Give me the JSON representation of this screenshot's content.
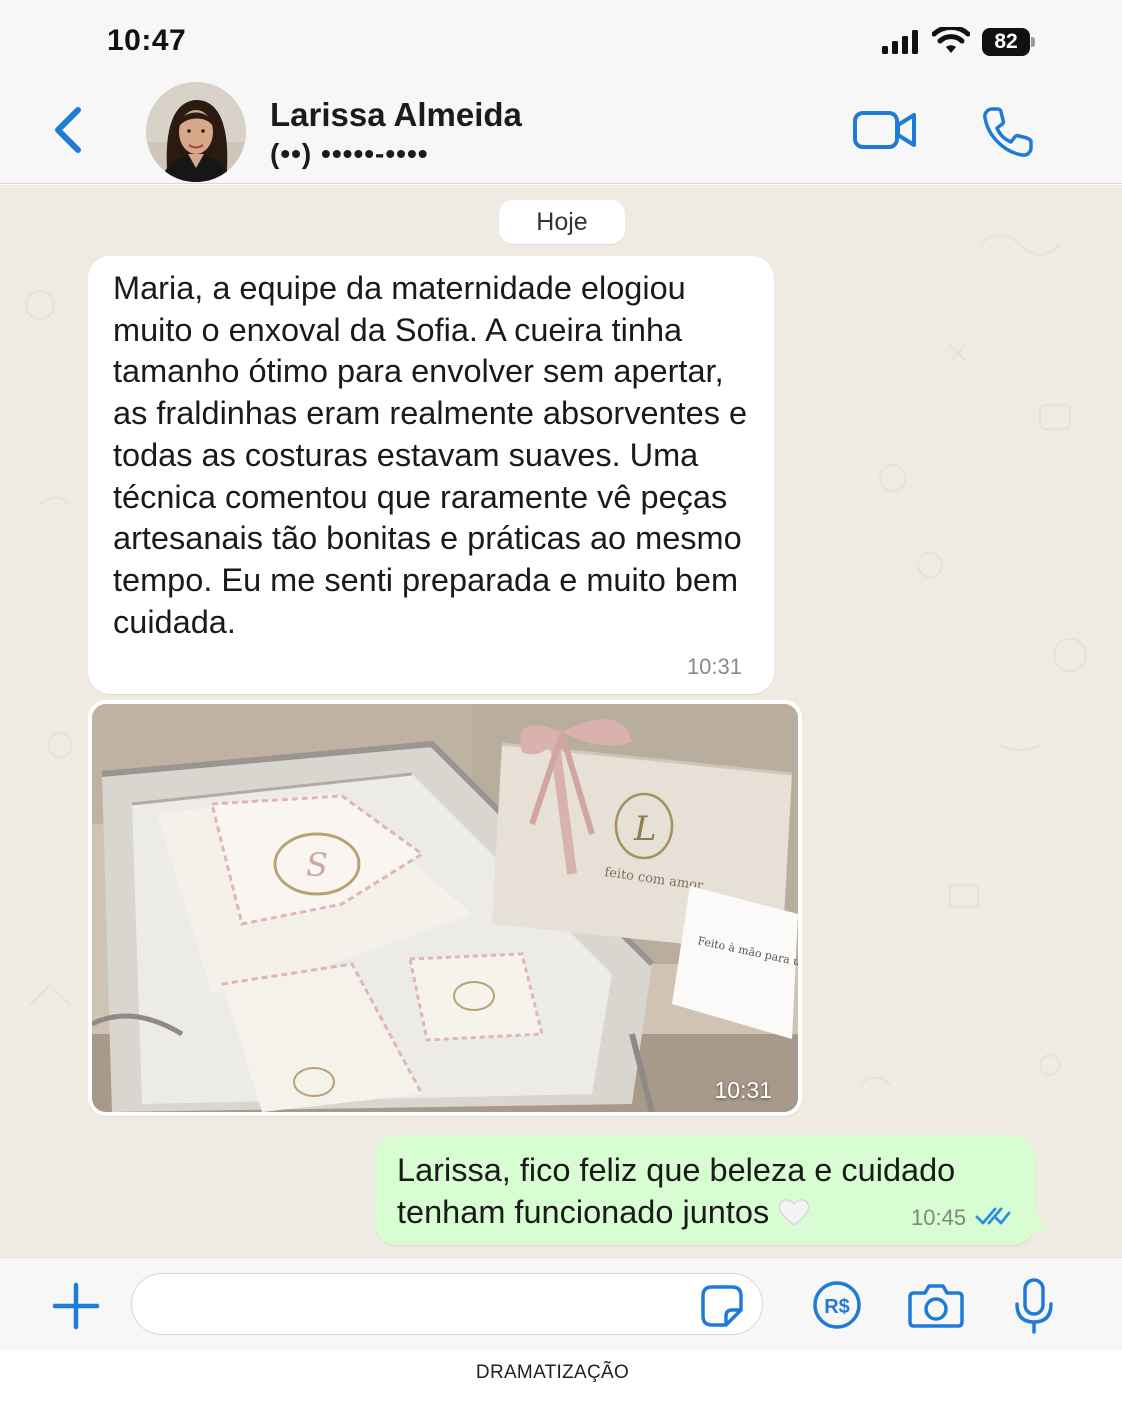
{
  "status_bar": {
    "time": "10:47",
    "battery": "82"
  },
  "header": {
    "contact_name": "Larissa Almeida",
    "contact_phone": "(••) •••••-••••"
  },
  "chat": {
    "date_label": "Hoje",
    "messages": [
      {
        "direction": "incoming",
        "text": "Maria, a equipe da maternidade elogiou muito o enxoval da Sofia. A cueira tinha tamanho ótimo para envolver sem apertar, as fraldinhas eram realmente absorventes e todas as costuras estavam suaves. Uma técnica comentou que raramente vê peças artesanais tão bonitas e práticas ao mesmo tempo. Eu me senti preparada e muito bem cuidada.",
        "time": "10:31"
      },
      {
        "direction": "incoming",
        "type": "image",
        "image": {
          "gift_box_text": "feito com amor",
          "gift_box_monogram": "L",
          "card_text": "Feito à mão para um amor que nasceu.",
          "blanket_monogram": "S"
        },
        "time": "10:31"
      },
      {
        "direction": "outgoing",
        "text": "Larissa, fico feliz que beleza e cuidado tenham funcionado juntos",
        "emoji": "white-heart",
        "time": "10:45",
        "status": "read"
      }
    ]
  },
  "input": {
    "placeholder": "",
    "value": ""
  },
  "footer": {
    "disclaimer": "DRAMATIZAÇÃO"
  },
  "colors": {
    "accent": "#1f7bd8",
    "chat_background": "#efeae2",
    "outgoing_bubble": "#d9fdd3",
    "incoming_bubble": "#ffffff"
  }
}
